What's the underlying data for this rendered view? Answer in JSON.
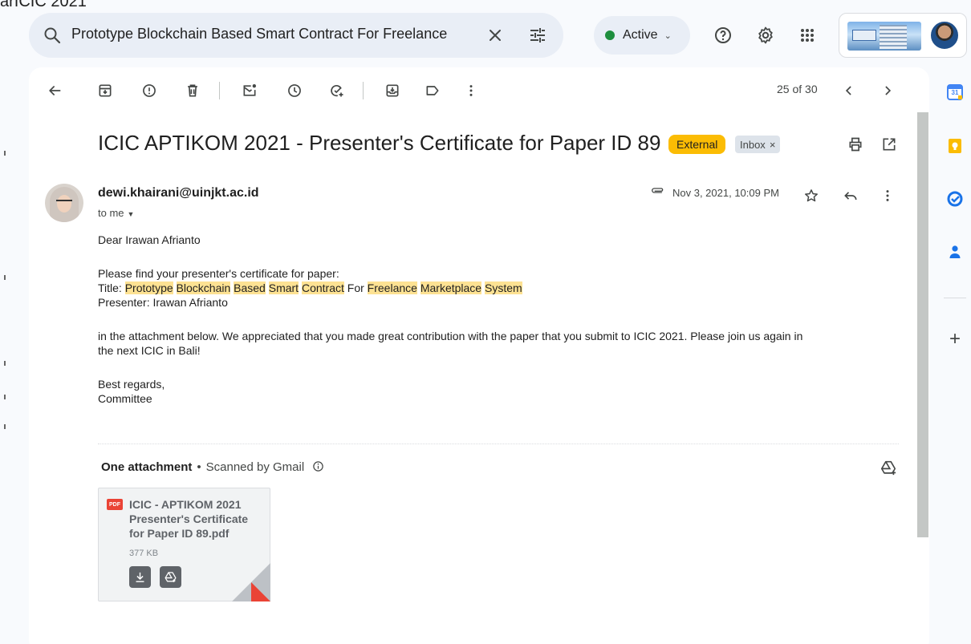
{
  "top_fragment": "arICIC 2021",
  "search": {
    "value": "Prototype Blockchain Based Smart Contract For Freelance"
  },
  "status": {
    "label": "Active",
    "color": "#1e8e3e"
  },
  "toolbar": {
    "counter": "25 of 30"
  },
  "email": {
    "subject": "ICIC APTIKOM 2021 - Presenter's Certificate for Paper ID 89",
    "labels": {
      "external": "External",
      "inbox": "Inbox",
      "inbox_remove": "×"
    },
    "sender": "dewi.khairani@uinjkt.ac.id",
    "to": "to me",
    "date": "Nov 3, 2021, 10:09 PM",
    "body": {
      "greeting": "Dear Irawan Afrianto",
      "intro": "Please find your presenter's certificate for paper:",
      "title_label": "Title: ",
      "title_words": [
        "Prototype",
        "Blockchain",
        "Based",
        "Smart",
        "Contract",
        "For",
        "Freelance",
        "Marketplace",
        "System"
      ],
      "title_highlighted": [
        true,
        true,
        true,
        true,
        true,
        false,
        true,
        true,
        true
      ],
      "presenter": "Presenter: Irawan Afrianto",
      "paragraph_line1": "in the attachment below. We appreciated that you made great contribution with the paper that you submit to ICIC 2021. Please join us again in",
      "paragraph_line2": "the next ICIC in Bali!",
      "closing": "Best regards,",
      "signature": "Committee"
    }
  },
  "attachments": {
    "heading": "One attachment",
    "separator": "•",
    "scanned": "Scanned by Gmail",
    "file": {
      "type_badge": "PDF",
      "name": "ICIC - APTIKOM 2021 Presenter's Certificate for Paper ID 89.pdf",
      "size": "377 KB"
    }
  },
  "side_panel": {
    "calendar_day": "31"
  },
  "colors": {
    "accent_highlight": "#fde293",
    "external_chip": "#fbbc04",
    "pdf_red": "#ea4335"
  }
}
